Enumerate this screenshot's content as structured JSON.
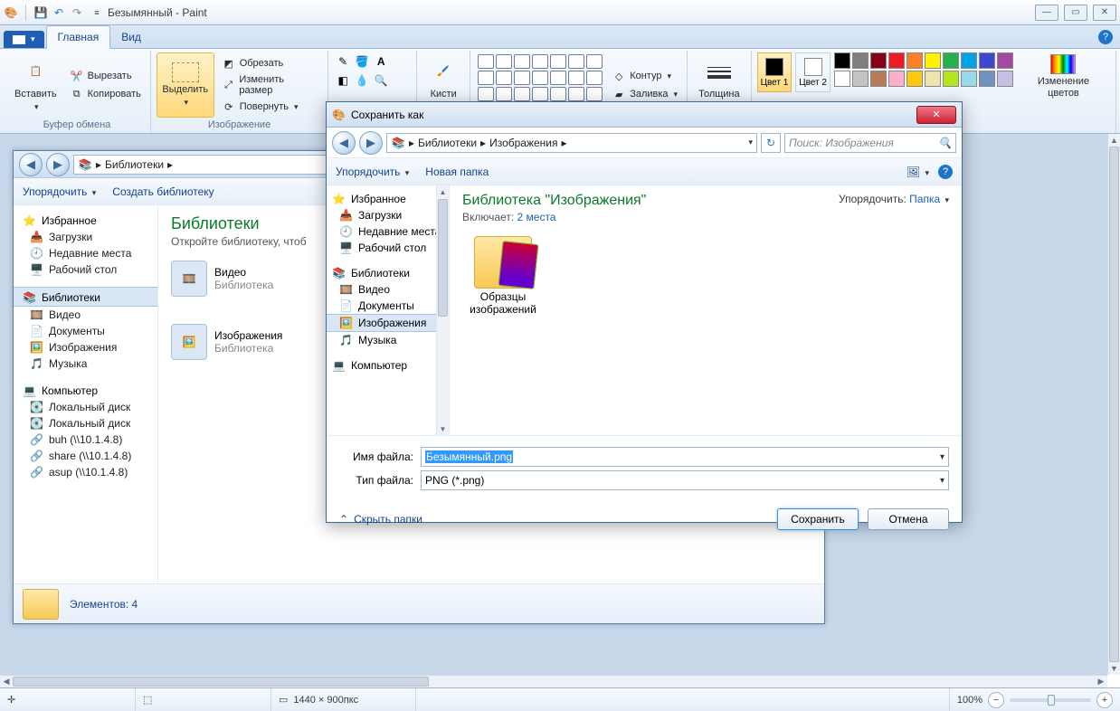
{
  "title": "Безымянный - Paint",
  "tabs": {
    "file": "",
    "main": "Главная",
    "view": "Вид"
  },
  "ribbon": {
    "clipboard": {
      "paste": "Вставить",
      "cut": "Вырезать",
      "copy": "Копировать",
      "label": "Буфер обмена"
    },
    "image": {
      "select": "Выделить",
      "crop": "Обрезать",
      "resize": "Изменить размер",
      "rotate": "Повернуть",
      "label": "Изображение"
    },
    "tools": {
      "brush": "Кисти"
    },
    "shapes": {
      "outline": "Контур",
      "fill": "Заливка"
    },
    "thickness": "Толщина",
    "colors": {
      "color1": "Цвет 1",
      "color2": "Цвет 2",
      "edit": "Изменение цветов",
      "palette_top": [
        "#000000",
        "#7f7f7f",
        "#880015",
        "#ed1c24",
        "#ff7f27",
        "#fff200",
        "#22b14c",
        "#00a2e8",
        "#3f48cc",
        "#a349a4"
      ],
      "palette_bot": [
        "#ffffff",
        "#c3c3c3",
        "#b97a57",
        "#ffaec9",
        "#ffc90e",
        "#efe4b0",
        "#b5e61d",
        "#99d9ea",
        "#7092be",
        "#c8bfe7"
      ],
      "c1_value": "#000000",
      "c2_value": "#ffffff"
    }
  },
  "status": {
    "size": "1440 × 900пкс",
    "zoom": "100%"
  },
  "explorer_bg": {
    "breadcrumb": [
      "Библиотеки"
    ],
    "toolbar": {
      "organize": "Упорядочить",
      "new_lib": "Создать библиотеку"
    },
    "nav": {
      "favorites": "Избранное",
      "fav_items": [
        "Загрузки",
        "Недавние места",
        "Рабочий стол"
      ],
      "libraries": "Библиотеки",
      "lib_items": [
        "Видео",
        "Документы",
        "Изображения",
        "Музыка"
      ],
      "computer": "Компьютер",
      "comp_items": [
        "Локальный диск",
        "Локальный диск",
        "buh (\\\\10.1.4.8)",
        "share (\\\\10.1.4.8)",
        "asup (\\\\10.1.4.8)"
      ]
    },
    "content": {
      "title": "Библиотеки",
      "sub": "Откройте библиотеку, чтоб",
      "items": [
        {
          "name": "Видео",
          "sub": "Библиотека"
        },
        {
          "name": "Изображения",
          "sub": "Библиотека"
        }
      ]
    },
    "status": "Элементов: 4"
  },
  "dialog": {
    "title": "Сохранить как",
    "breadcrumb": [
      "Библиотеки",
      "Изображения"
    ],
    "search_placeholder": "Поиск: Изображения",
    "toolbar": {
      "organize": "Упорядочить",
      "new_folder": "Новая папка"
    },
    "nav": {
      "favorites": "Избранное",
      "fav_items": [
        "Загрузки",
        "Недавние места",
        "Рабочий стол"
      ],
      "libraries": "Библиотеки",
      "lib_items": [
        "Видео",
        "Документы",
        "Изображения",
        "Музыка"
      ],
      "computer": "Компьютер"
    },
    "content": {
      "title": "Библиотека \"Изображения\"",
      "includes_label": "Включает:",
      "includes_link": "2 места",
      "sort_label": "Упорядочить:",
      "sort_value": "Папка",
      "item": "Образцы изображений"
    },
    "fields": {
      "name_label": "Имя файла:",
      "name_value": "Безымянный.png",
      "type_label": "Тип файла:",
      "type_value": "PNG (*.png)"
    },
    "hide_folders": "Скрыть папки",
    "save": "Сохранить",
    "cancel": "Отмена"
  }
}
